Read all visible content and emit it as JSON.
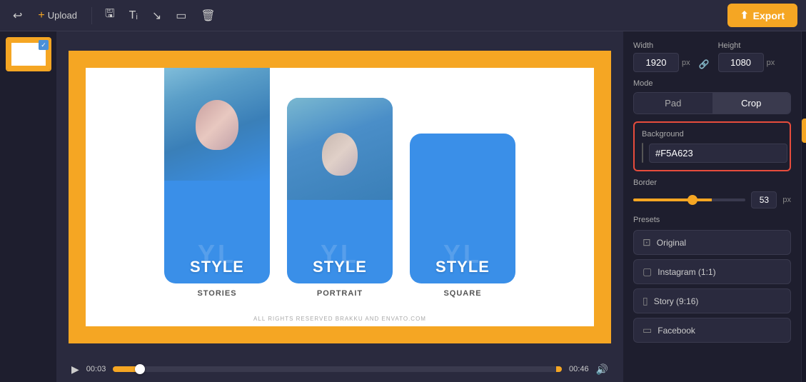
{
  "toolbar": {
    "upload_label": "Upload",
    "export_label": "Export",
    "upload_plus": "+"
  },
  "canvas": {
    "time_start": "00:03",
    "time_end": "00:46"
  },
  "properties": {
    "width_label": "Width",
    "height_label": "Height",
    "width_value": "1920",
    "height_value": "1080",
    "unit": "px",
    "mode_label": "Mode",
    "mode_pad": "Pad",
    "mode_crop": "Crop",
    "bg_label": "Background",
    "bg_color": "#F5A623",
    "border_label": "Border",
    "border_value": "53",
    "presets_label": "Presets",
    "preset_original": "Original",
    "preset_instagram": "Instagram (1:1)",
    "preset_story": "Story (9:16)",
    "preset_facebook": "Facebook"
  },
  "cards": [
    {
      "label": "STORIES",
      "style_text": "STYLE"
    },
    {
      "label": "PORTRAIT",
      "style_text": "STYLE"
    },
    {
      "label": "SQUARE",
      "style_text": "STYLE"
    }
  ],
  "copyright": "ALL RIGHTS RESERVED BRAKKU AND ENVATO.COM",
  "icon_bar": {
    "grid": "⊞",
    "layers": "☰",
    "crop_icon": "⊡",
    "anchor": "⊕",
    "text": "T",
    "elements": "⁘",
    "sliders": "≡",
    "template": "⊟"
  }
}
